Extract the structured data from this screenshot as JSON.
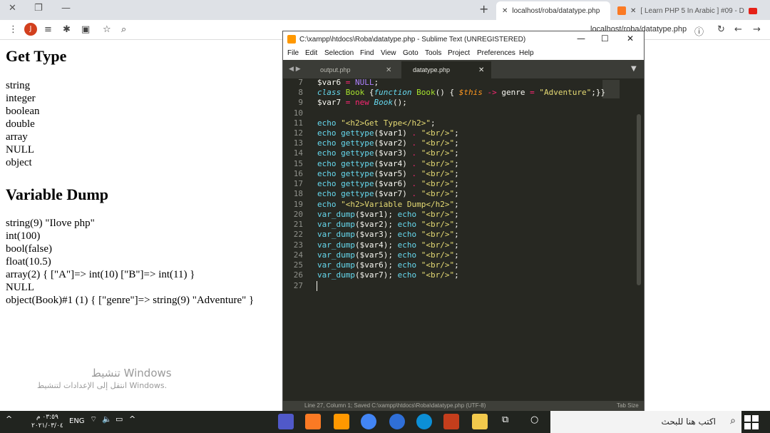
{
  "browser": {
    "window_controls": {
      "close": "✕",
      "restore": "❐",
      "minimize": "—"
    },
    "tabs": [
      {
        "label": "localhost/roba/datatype.php"
      },
      {
        "label": "[ Learn PHP 5 In Arabic ] #09 - D"
      }
    ],
    "new_tab": "+",
    "avatar_initial": "J",
    "url": "localhost/roba/datatype.php"
  },
  "page": {
    "heading_type": "Get Type",
    "types": [
      "string",
      "integer",
      "boolean",
      "double",
      "array",
      "NULL",
      "object"
    ],
    "heading_dump": "Variable Dump",
    "dumps": [
      "string(9) \"Ilove php\"",
      "int(100)",
      "bool(false)",
      "float(10.5)",
      "array(2) { [\"A\"]=> int(10) [\"B\"]=> int(11) }",
      "NULL",
      "object(Book)#1 (1) { [\"genre\"]=> string(9) \"Adventure\" }"
    ],
    "watermark_title": "تنشيط Windows",
    "watermark_sub": "انتقل إلى الإعدادات لتنشيط Windows."
  },
  "sublime": {
    "title": "C:\\xampp\\htdocs\\Roba\\datatype.php - Sublime Text (UNREGISTERED)",
    "menu": [
      "File",
      "Edit",
      "Selection",
      "Find",
      "View",
      "Goto",
      "Tools",
      "Project",
      "Preferences",
      "Help"
    ],
    "tabs": [
      {
        "label": "output.php"
      },
      {
        "label": "datatype.php"
      }
    ],
    "line_numbers": [
      "7",
      "8",
      "9",
      "10",
      "11",
      "12",
      "13",
      "14",
      "15",
      "16",
      "17",
      "18",
      "19",
      "20",
      "21",
      "22",
      "23",
      "24",
      "25",
      "26",
      "27"
    ],
    "status_left": "Line 27, Column 1; Saved C:\\xampp\\htdocs\\Roba\\datatype.php (UTF-8)",
    "status_right": "Tab Size"
  },
  "taskbar": {
    "search_placeholder": "اكتب هنا للبحث",
    "language": "ENG",
    "time": "٠٣:٥٩ م",
    "date": "٢٠٢١/٠٣/٠٤"
  }
}
